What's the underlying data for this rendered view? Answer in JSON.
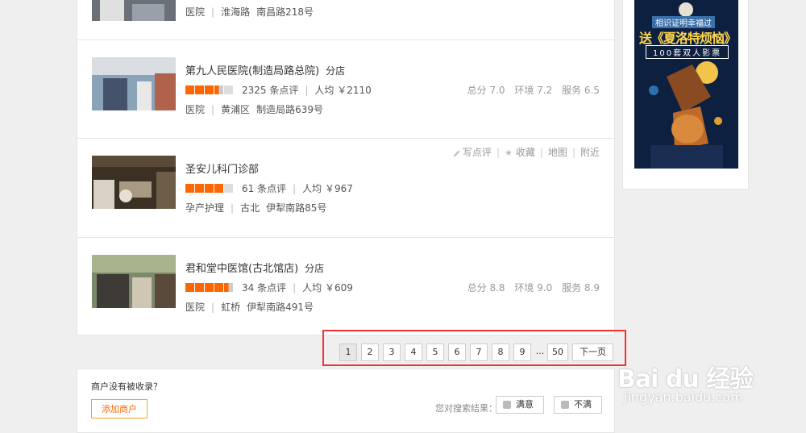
{
  "listings": [
    {
      "name": "",
      "tag": "",
      "rating": null,
      "reviews": "",
      "avg": "",
      "category": "医院",
      "district": "淮海路",
      "address": "南昌路218号",
      "scores": null
    },
    {
      "name": "第九人民医院(制造局路总院)",
      "tag": "分店",
      "rating": 3.5,
      "reviews": "2325 条点评",
      "avg": "人均 ￥2110",
      "category": "医院",
      "district": "黄浦区",
      "address": "制造局路639号",
      "scores": {
        "overall": "总分 7.0",
        "env": "环境 7.2",
        "service": "服务 6.5"
      }
    },
    {
      "name": "圣安儿科门诊部",
      "tag": "",
      "rating": 4,
      "reviews": "61 条点评",
      "avg": "人均 ￥967",
      "category": "孕产护理",
      "district": "古北",
      "address": "伊犁南路85号",
      "scores": null
    },
    {
      "name": "君和堂中医馆(古北馆店)",
      "tag": "分店",
      "rating": 4.5,
      "reviews": "34 条点评",
      "avg": "人均 ￥609",
      "category": "医院",
      "district": "虹桥",
      "address": "伊犁南路491号",
      "scores": {
        "overall": "总分 8.8",
        "env": "环境 9.0",
        "service": "服务 8.9"
      }
    }
  ],
  "hover_actions": {
    "review": "写点评",
    "favorite": "收藏",
    "map": "地图",
    "nearby": "附近"
  },
  "pagination": {
    "pages": [
      "1",
      "2",
      "3",
      "4",
      "5",
      "6",
      "7",
      "8",
      "9"
    ],
    "ellipsis": "...",
    "last": "50",
    "next": "下一页",
    "current": "1"
  },
  "footer": {
    "question": "商户没有被收录？",
    "add_button": "添加商户",
    "feedback_label": "您对搜索结果：",
    "satisfied": "满意",
    "unsatisfied": "不满"
  },
  "ad": {
    "line1": "相识证明幸福过",
    "line2": "送《夏洛特烦恼》",
    "line3": "100套双人影票"
  },
  "watermark": {
    "brand": "Bai du 经验",
    "url": "jingyan.baidu.com"
  },
  "colors": {
    "star": "#ff6600",
    "highlight_border": "#ee3333",
    "accent": "#ff6600"
  }
}
